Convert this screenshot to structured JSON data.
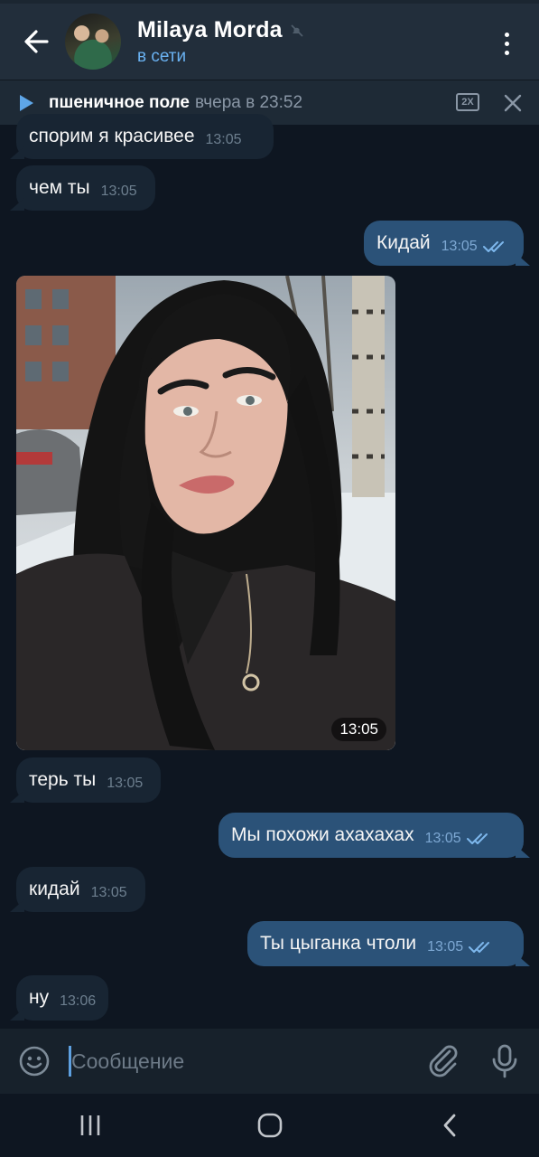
{
  "header": {
    "title": "Milaya Morda",
    "status": "в сети"
  },
  "player": {
    "title": "пшеничное поле",
    "time": "вчера в 23:52",
    "speed": "2X"
  },
  "messages": [
    {
      "direction": "in",
      "text": "спорим я красивее",
      "time": "13:05"
    },
    {
      "direction": "in",
      "text": "чем ты",
      "time": "13:05"
    },
    {
      "direction": "out",
      "text": "Кидай",
      "time": "13:05",
      "read": true
    },
    {
      "direction": "in",
      "type": "photo",
      "time": "13:05"
    },
    {
      "direction": "in",
      "text": "терь ты",
      "time": "13:05"
    },
    {
      "direction": "out",
      "text": "Мы похожи ахахахах",
      "time": "13:05",
      "read": true
    },
    {
      "direction": "in",
      "text": "кидай",
      "time": "13:05"
    },
    {
      "direction": "out",
      "text": "Ты цыганка чтоли",
      "time": "13:05",
      "read": true
    },
    {
      "direction": "in",
      "text": "ну",
      "time": "13:06"
    }
  ],
  "composer": {
    "placeholder": "Сообщение"
  },
  "icons": {
    "back": "arrow-left-icon",
    "mute": "muted-bell-icon",
    "menu": "more-vertical-icon",
    "play": "play-icon",
    "close": "close-icon",
    "read": "double-check-icon",
    "emoji": "emoji-icon",
    "attach": "paperclip-icon",
    "mic": "microphone-icon",
    "nav_recent": "recents-icon",
    "nav_home": "home-icon",
    "nav_back": "nav-back-icon"
  },
  "colors": {
    "background": "#0e1621",
    "header": "#222e3b",
    "incoming_bubble": "#182533",
    "outgoing_bubble": "#2b5278",
    "accent": "#6ab2f2"
  }
}
